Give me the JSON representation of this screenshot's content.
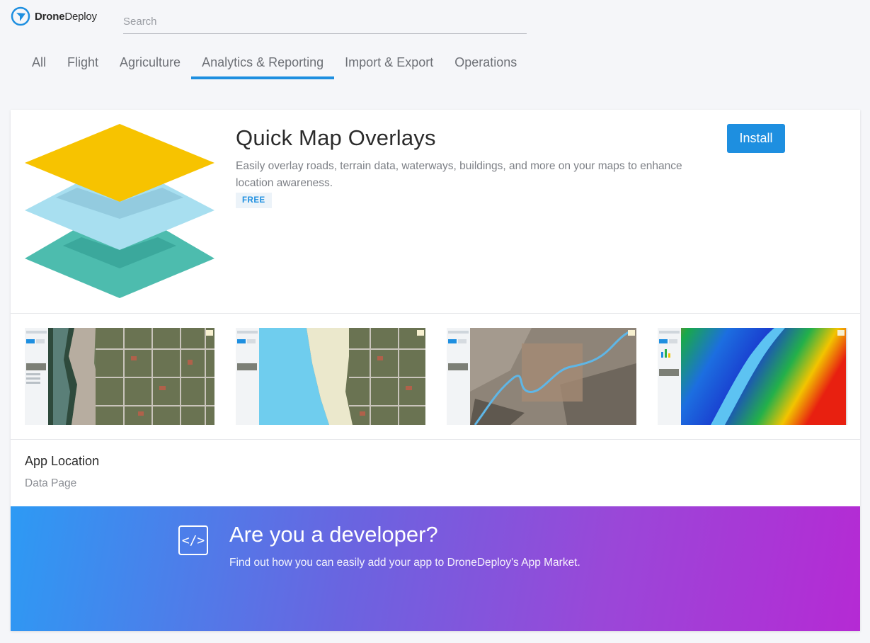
{
  "header": {
    "logo_bold": "Drone",
    "logo_light": "Deploy",
    "search_placeholder": "Search"
  },
  "tabs": [
    {
      "label": "All",
      "active": false
    },
    {
      "label": "Flight",
      "active": false
    },
    {
      "label": "Agriculture",
      "active": false
    },
    {
      "label": "Analytics & Reporting",
      "active": true
    },
    {
      "label": "Import & Export",
      "active": false
    },
    {
      "label": "Operations",
      "active": false
    }
  ],
  "app": {
    "title": "Quick Map Overlays",
    "description": "Easily overlay roads, terrain data, waterways, buildings, and more on your maps to enhance location awareness.",
    "badge": "FREE",
    "install_label": "Install",
    "icon": "layers-icon",
    "screenshots": [
      {
        "name": "screenshot-satellite"
      },
      {
        "name": "screenshot-water-overlay"
      },
      {
        "name": "screenshot-terrain-river"
      },
      {
        "name": "screenshot-elevation-heatmap"
      }
    ],
    "location_label": "App Location",
    "location_value": "Data Page"
  },
  "developer": {
    "title": "Are you a developer?",
    "subtitle": "Find out how you can easily add your app to DroneDeploy's App Market.",
    "icon_glyph": "</>"
  },
  "colors": {
    "accent": "#1e8fe0",
    "layer_top": "#f7c300",
    "layer_mid": "#a8dff0",
    "layer_bottom": "#4dbcae"
  }
}
